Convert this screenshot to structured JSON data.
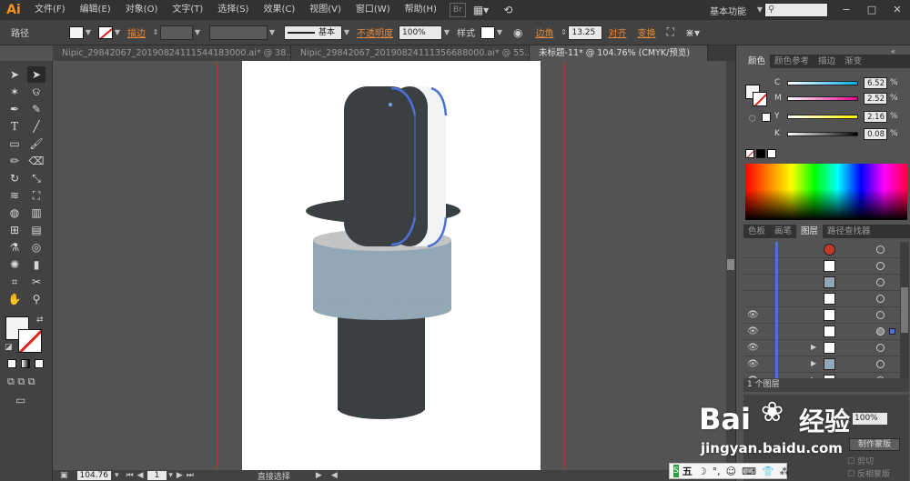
{
  "app": {
    "logo": "Ai"
  },
  "menu": [
    "文件(F)",
    "编辑(E)",
    "对象(O)",
    "文字(T)",
    "选择(S)",
    "效果(C)",
    "视图(V)",
    "窗口(W)",
    "帮助(H)"
  ],
  "workspace": "基本功能",
  "search_placeholder": "",
  "control": {
    "selection_label": "路径",
    "stroke_label": "描边",
    "stroke_style": "基本",
    "opacity_label": "不透明度",
    "opacity_value": "100%",
    "style_label": "样式",
    "corner_label": "边角",
    "corner_value": "13.25",
    "align_label": "对齐",
    "transform_label": "变换"
  },
  "tabs": [
    {
      "label": "Nipic_29842067_20190824111544183000.ai* @ 38...",
      "active": false
    },
    {
      "label": "Nipic_29842067_20190824111356688000.ai* @ 55...",
      "active": false
    },
    {
      "label": "未标题-11* @ 104.76% (CMYK/预览)",
      "active": true
    }
  ],
  "color_panel": {
    "tabs": [
      "颜色",
      "颜色参考",
      "描边",
      "渐变"
    ],
    "active_tab": "颜色",
    "channels": [
      {
        "label": "C",
        "value": "6.52",
        "gradient": "linear-gradient(90deg,#ffffff,#00aeef)"
      },
      {
        "label": "M",
        "value": "2.52",
        "gradient": "linear-gradient(90deg,#ffffff,#ec008c)"
      },
      {
        "label": "Y",
        "value": "2.16",
        "gradient": "linear-gradient(90deg,#ffffff,#fff200)"
      },
      {
        "label": "K",
        "value": "0.08",
        "gradient": "linear-gradient(90deg,#ffffff,#000000)"
      }
    ],
    "pct": "%"
  },
  "layers_panel": {
    "tabs": [
      "色板",
      "画笔",
      "图层",
      "路径查找器"
    ],
    "active_tab": "图层",
    "footer_count": "1 个图层"
  },
  "transparency": {
    "opacity_value": "100%",
    "make_mask": "制作蒙版",
    "clip": "剪切",
    "invert": "反相蒙版"
  },
  "status": {
    "zoom": "104.76",
    "page": "1",
    "tool": "直接选择"
  },
  "watermark": {
    "brand": "Bai",
    "brand2": "经验",
    "url": "jingyan.baidu.com"
  },
  "ime": {
    "label": "五"
  },
  "colors": {
    "cup_dark": "#3a3f42",
    "cup_blue": "#94a7b4",
    "cup_light": "#c2c4c6",
    "highlight": "#4a72d9",
    "accent_orange": "#e58a3c"
  }
}
